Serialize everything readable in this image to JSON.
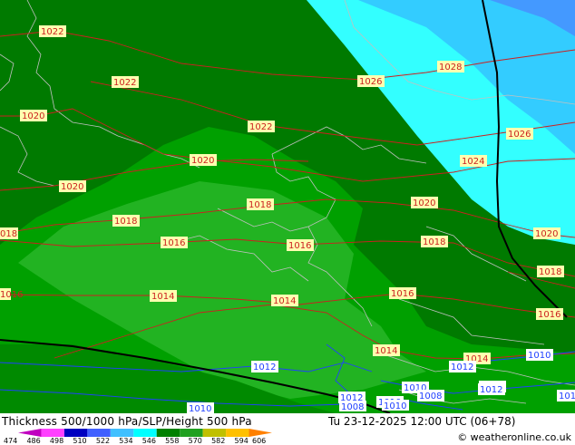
{
  "footer": {
    "title": "Thickness 500/1000 hPa/SLP/Height 500 hPa",
    "datetime": "Tu 23-12-2025 12:00 UTC (06+78)",
    "credit": "© weatheronline.co.uk"
  },
  "legend": {
    "values": [
      "474",
      "486",
      "498",
      "510",
      "522",
      "534",
      "546",
      "558",
      "570",
      "582",
      "594",
      "606"
    ],
    "colors": [
      "#c000c0",
      "#ff40ff",
      "#0000c0",
      "#4060ff",
      "#40c0ff",
      "#00ffff",
      "#008000",
      "#20a020",
      "#c0c000",
      "#ffc000",
      "#ff8000"
    ]
  },
  "isobars": {
    "red": [
      "1022",
      "1022",
      "1020",
      "1022",
      "1026",
      "1028",
      "1026",
      "1024",
      "1020",
      "1020",
      "1020",
      "018",
      "1018",
      "1018",
      "1016",
      "1018",
      "1020",
      "1018",
      "1016",
      "1016",
      "1014",
      "1014",
      "1016",
      "1016",
      "1014",
      "1014"
    ],
    "blue": [
      "1012",
      "1010",
      "1012",
      "1012",
      "1010",
      "1008",
      "1010",
      "1012",
      "1010",
      "1008",
      "1012",
      "1012",
      "1010"
    ]
  },
  "colors": {
    "dark_green": "#007a00",
    "mid_green": "#00a000",
    "light_green": "#22b322",
    "cyan": "#33ffff",
    "light_blue": "#33ccff",
    "blue": "#4499ff",
    "isobar_red": "#cc2020",
    "isobar_blue": "#2040ff",
    "border": "#c0c0c0",
    "label_bg": "#ffffb0"
  }
}
